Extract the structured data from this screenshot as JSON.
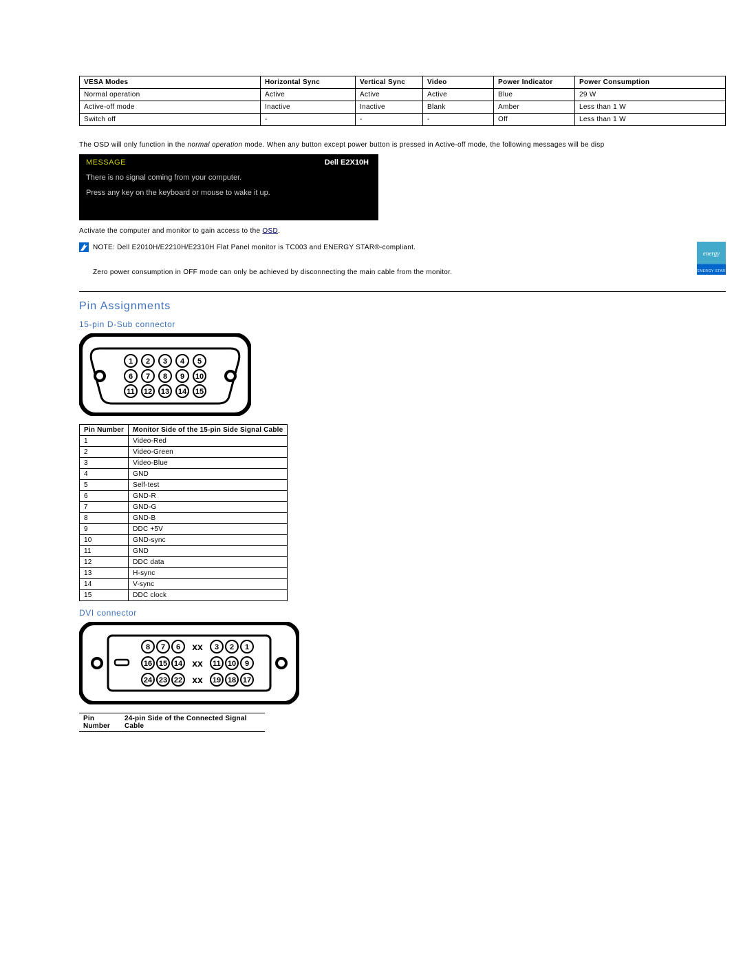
{
  "vesa_table": {
    "headers": [
      "VESA Modes",
      "Horizontal Sync",
      "Vertical Sync",
      "Video",
      "Power Indicator",
      "Power Consumption"
    ],
    "rows": [
      [
        "Normal operation",
        "Active",
        "Active",
        "Active",
        "Blue",
        "29 W"
      ],
      [
        "Active-off mode",
        "Inactive",
        "Inactive",
        "Blank",
        "Amber",
        "Less than 1 W"
      ],
      [
        "Switch off",
        "-",
        "-",
        "-",
        "Off",
        "Less than 1 W"
      ]
    ]
  },
  "osd_paragraph_prefix": "The OSD will only function in the ",
  "osd_paragraph_em": "normal operation",
  "osd_paragraph_suffix": " mode. When any button except power button is pressed in Active-off mode, the following messages will be disp",
  "osd_box": {
    "label": "MESSAGE",
    "model": "Dell E2X10H",
    "line1": "There is no signal coming from your computer.",
    "line2": "Press any key on the keyboard or mouse to wake it up."
  },
  "activate_prefix": "Activate the computer and monitor to gain access to the ",
  "activate_link": "OSD",
  "activate_suffix": ".",
  "note_label": "NOTE:",
  "note_line1": " Dell E2010H/E2210H/E2310H Flat Panel monitor is TC003 and ENERGY STAR®-compliant.",
  "note_line2": "Zero power consumption in OFF mode can only be achieved by disconnecting the main cable from the monitor.",
  "energy_star_script": "energy",
  "energy_star_label": "ENERGY STAR",
  "pin_section_title": "Pin Assignments",
  "dsub_title": "15-pin D-Sub connector",
  "dsub_table": {
    "headers": [
      "Pin Number",
      "Monitor Side of the 15-pin Side Signal Cable"
    ],
    "rows": [
      [
        "1",
        "Video-Red"
      ],
      [
        "2",
        "Video-Green"
      ],
      [
        "3",
        "Video-Blue"
      ],
      [
        "4",
        "GND"
      ],
      [
        "5",
        "Self-test"
      ],
      [
        "6",
        "GND-R"
      ],
      [
        "7",
        "GND-G"
      ],
      [
        "8",
        "GND-B"
      ],
      [
        "9",
        "DDC +5V"
      ],
      [
        "10",
        "GND-sync"
      ],
      [
        "11",
        "GND"
      ],
      [
        "12",
        "DDC data"
      ],
      [
        "13",
        "H-sync"
      ],
      [
        "14",
        "V-sync"
      ],
      [
        "15",
        "DDC clock"
      ]
    ]
  },
  "dvi_title": "DVI connector",
  "dvi_header": {
    "col1": "Pin Number",
    "col2": "24-pin Side of the Connected Signal Cable"
  }
}
